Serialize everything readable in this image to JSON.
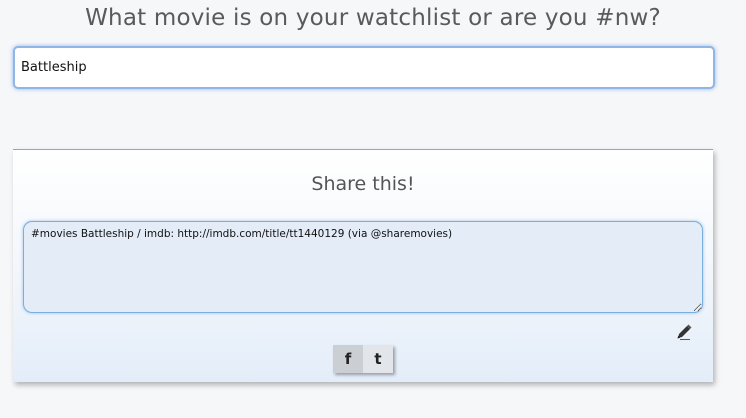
{
  "header": {
    "title": "What movie is on your watchlist or are you #nw?"
  },
  "search": {
    "value": "Battleship"
  },
  "share": {
    "heading": "Share this!",
    "message": "#movies Battleship / imdb: http://imdb.com/title/tt1440129 (via @sharemovies)",
    "facebook_label": "f",
    "twitter_label": "t"
  },
  "icons": {
    "edit": "pencil-icon"
  },
  "colors": {
    "title_text": "#5a5a5a",
    "input_focus_border": "#8fb6e6",
    "panel_top_border": "#6fb3d8",
    "textarea_bg": "#e3ecf7"
  }
}
